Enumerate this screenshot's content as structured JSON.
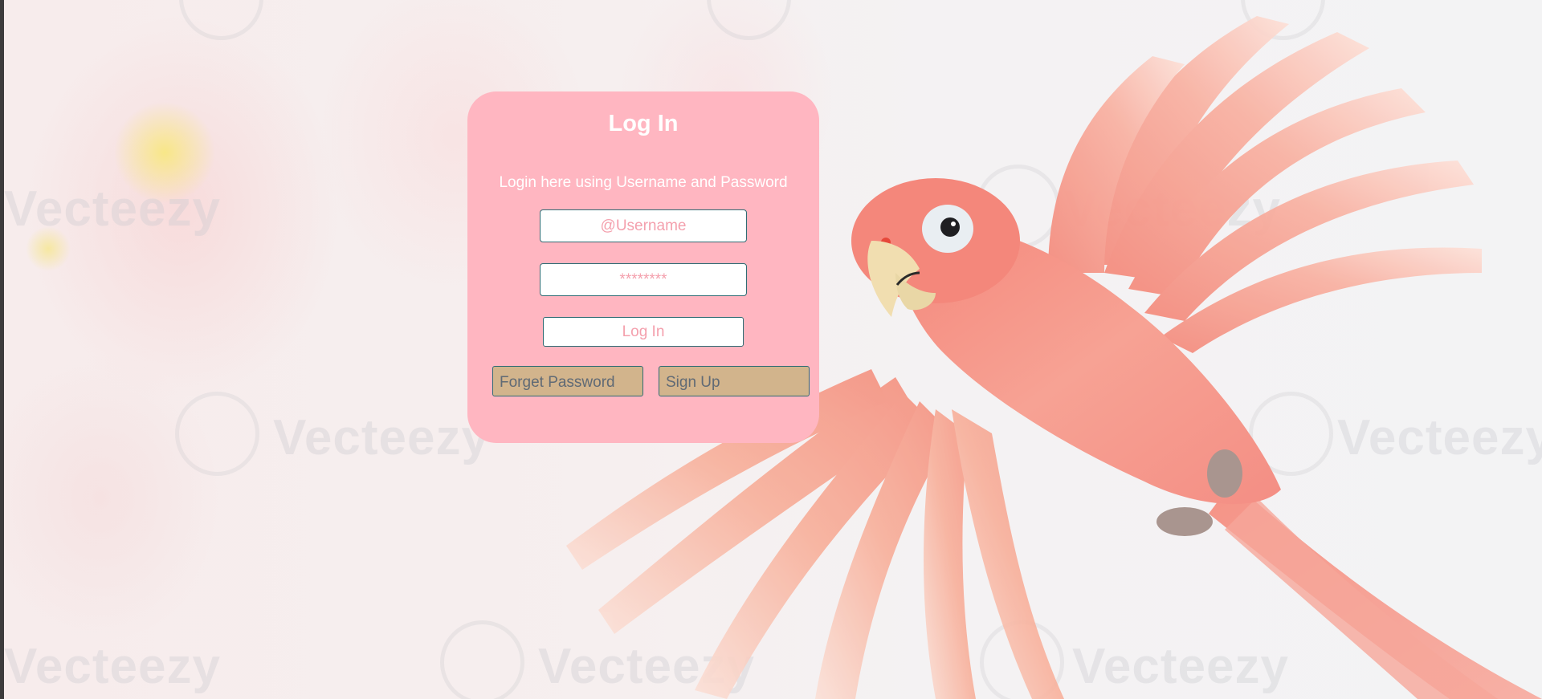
{
  "background": {
    "watermark_text": "Vecteezy",
    "description_icon": "parrot-illustration"
  },
  "login_card": {
    "title": "Log In",
    "subtitle": "Login here using Username and Password",
    "username_placeholder": "@Username",
    "password_placeholder": "********",
    "login_button_label": "Log In",
    "forget_password_label": "Forget Password",
    "signup_label": "Sign Up"
  },
  "colors": {
    "card_background": "#ffb6c1",
    "input_border": "#2f6c74",
    "input_text": "#f4a0ad",
    "secondary_button": "#d2b48c",
    "secondary_button_text": "#606a75",
    "parrot_pink": "#f79a8c"
  }
}
